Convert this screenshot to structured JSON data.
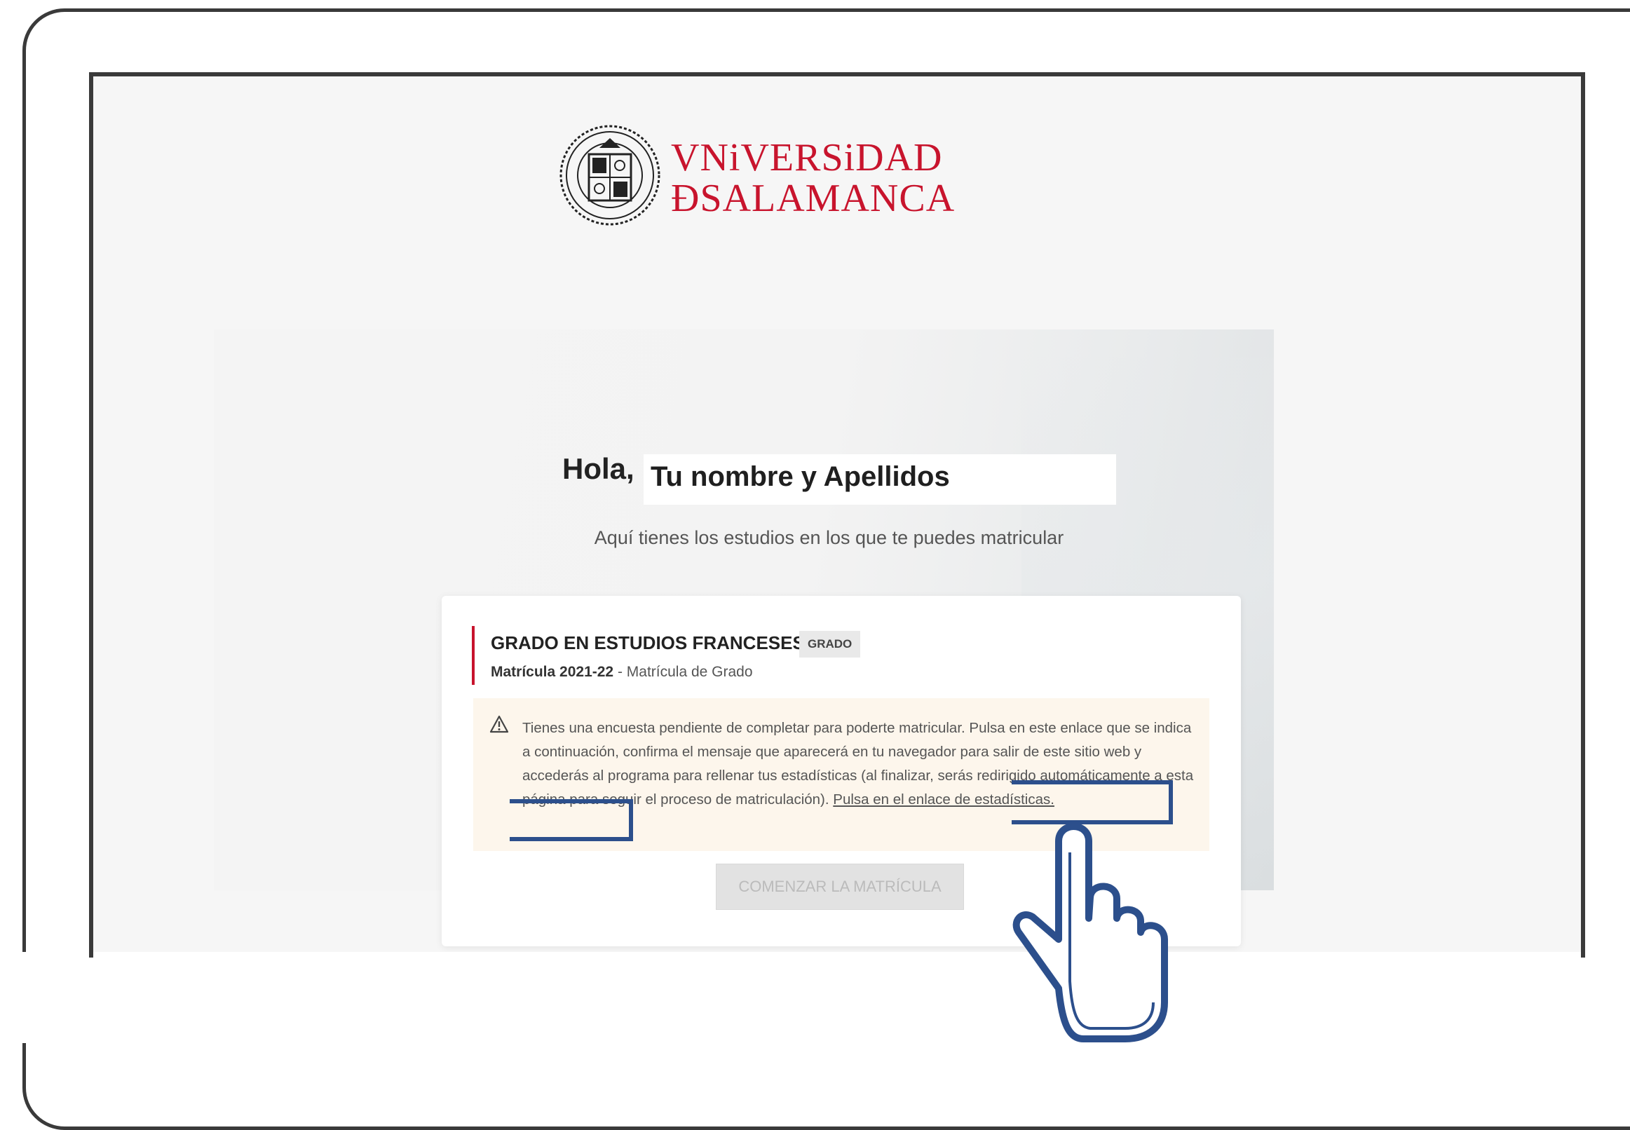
{
  "logo": {
    "line1": "VNiVERSiDAD",
    "line2": "ÐSALAMANCA"
  },
  "greeting": {
    "hello": "Hola,",
    "name": "Tu nombre y Apellidos",
    "subtitle": "Aquí tienes los estudios en los que te puedes matricular"
  },
  "card": {
    "title": "GRADO EN ESTUDIOS FRANCESES",
    "badge": "GRADO",
    "enrollment_bold": "Matrícula 2021-22",
    "enrollment_rest": " - Matrícula de Grado",
    "alert_text": "Tienes una encuesta pendiente de completar para poderte matricular. Pulsa en este enlace que se indica a continuación, confirma el mensaje que aparecerá en tu navegador para salir de este sitio web y accederás al programa para rellenar tus estadísticas (al finalizar, serás redirigido automáticamente a esta página para seguir el proceso de matriculación). ",
    "alert_link": "Pulsa en el enlace de estadísticas.",
    "start_button": "COMENZAR LA MATRÍCULA"
  },
  "colors": {
    "brand": "#c8142d",
    "highlight": "#2c4f8c"
  },
  "icons": [
    "university-seal-icon",
    "warning-triangle-icon",
    "pointing-hand-icon"
  ]
}
